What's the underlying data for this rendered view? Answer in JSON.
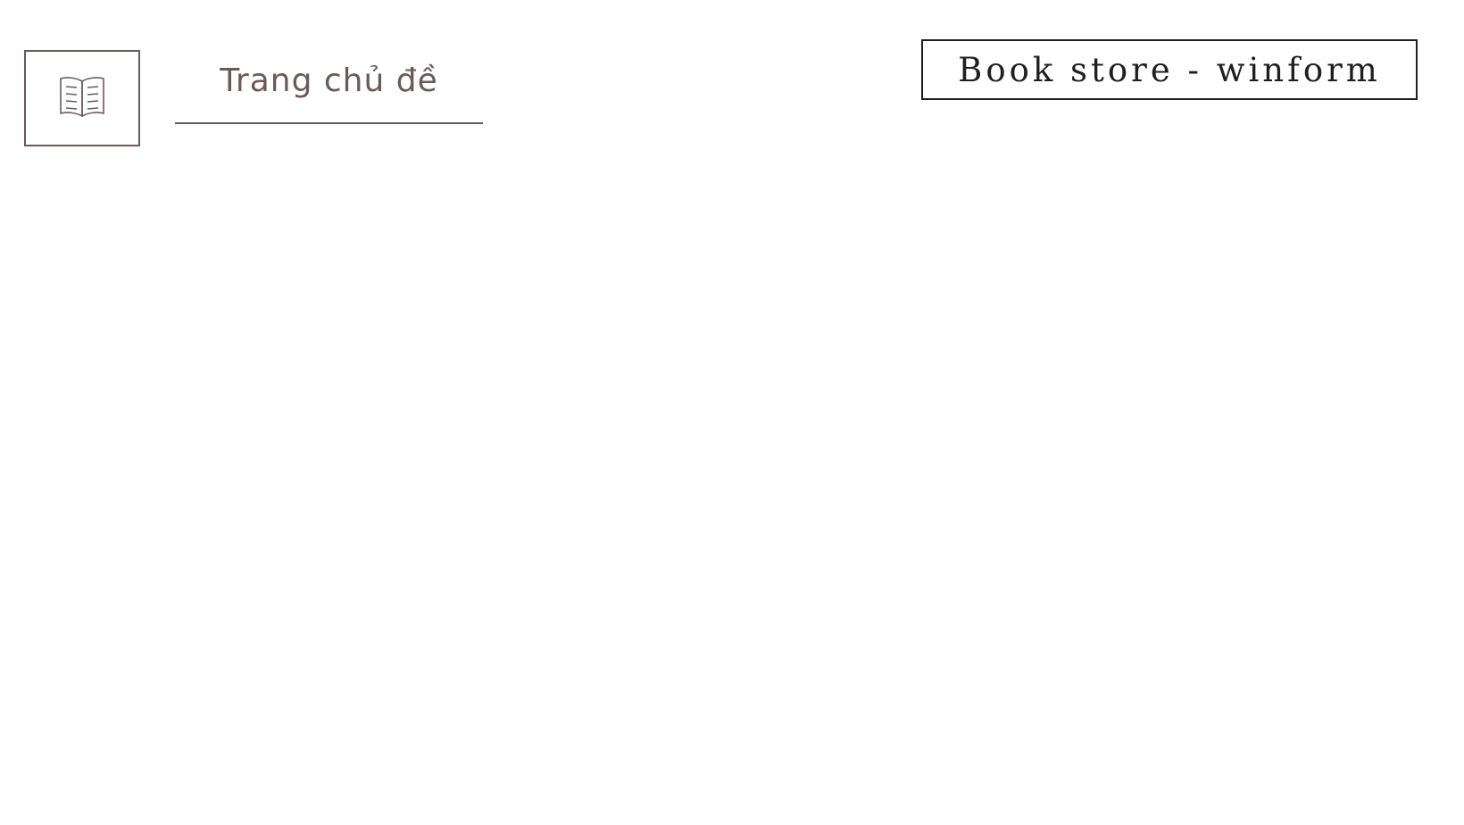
{
  "header": {
    "logo_icon": "open-book-icon",
    "title": "Trang chủ đề",
    "app_name": "Book store - winform"
  },
  "colors": {
    "accent": "#6b5a5c",
    "text_dark": "#1f1f1f",
    "background": "#ffffff"
  }
}
